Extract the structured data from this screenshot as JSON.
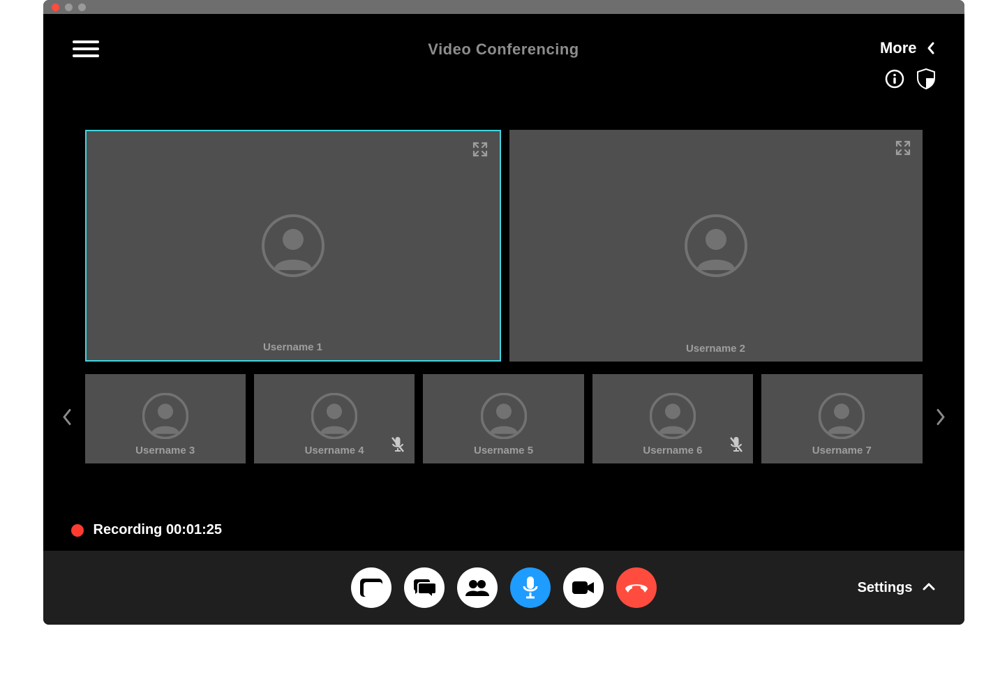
{
  "header": {
    "title": "Video Conferencing",
    "more_label": "More"
  },
  "participants": {
    "large": [
      {
        "name": "Username 1",
        "active": true
      },
      {
        "name": "Username 2",
        "active": false
      }
    ],
    "small": [
      {
        "name": "Username 3",
        "muted": false
      },
      {
        "name": "Username 4",
        "muted": true
      },
      {
        "name": "Username 5",
        "muted": false
      },
      {
        "name": "Username 6",
        "muted": true
      },
      {
        "name": "Username 7",
        "muted": false
      }
    ]
  },
  "recording": {
    "label": "Recording",
    "time": "00:01:25"
  },
  "footer": {
    "settings_label": "Settings"
  },
  "colors": {
    "active_border": "#41d6e0",
    "accent_blue": "#1e9cff",
    "accent_red": "#ff4c3e",
    "tile_bg": "#4f4f4f",
    "footer_bg": "#1f1f1f"
  }
}
